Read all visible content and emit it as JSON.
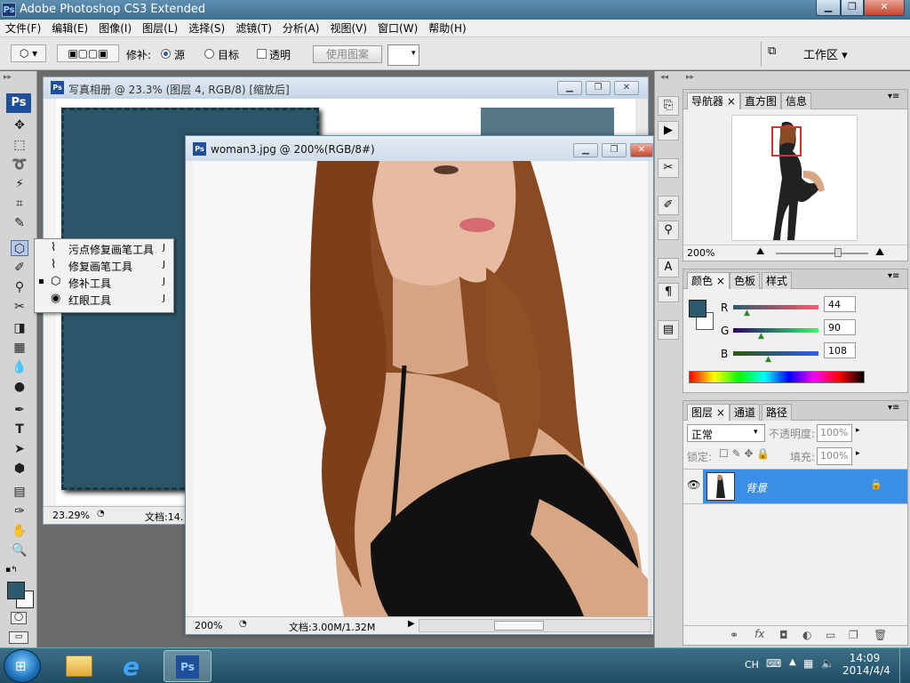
{
  "window": {
    "title": "Adobe Photoshop CS3 Extended",
    "logo": "Ps"
  },
  "menu": [
    "文件(F)",
    "编辑(E)",
    "图像(I)",
    "图层(L)",
    "选择(S)",
    "滤镜(T)",
    "分析(A)",
    "视图(V)",
    "窗口(W)",
    "帮助(H)"
  ],
  "options": {
    "patch_label": "修补:",
    "source_label": "源",
    "destination_label": "目标",
    "transparent_label": "透明",
    "use_pattern_label": "使用图案",
    "workspace_label": "工作区 ▾"
  },
  "toolbox": {
    "ps_label": "Ps"
  },
  "flyout": [
    {
      "label": "污点修复画笔工具",
      "key": "J",
      "active": false
    },
    {
      "label": "修复画笔工具",
      "key": "J",
      "active": false
    },
    {
      "label": "修补工具",
      "key": "J",
      "active": true
    },
    {
      "label": "红眼工具",
      "key": "J",
      "active": false
    }
  ],
  "doc1": {
    "title": "写真相册 @ 23.3% (图层 4, RGB/8) [缩放后]",
    "zoom": "23.29%",
    "doc_info": "文档:14."
  },
  "doc2": {
    "title": "woman3.jpg @ 200%(RGB/8#)",
    "zoom": "200%",
    "doc_info": "文档:3.00M/1.32M"
  },
  "navigator": {
    "tabs": [
      "导航器",
      "直方图",
      "信息"
    ],
    "zoom": "200%"
  },
  "color": {
    "tabs": [
      "颜色",
      "色板",
      "样式"
    ],
    "r_label": "R",
    "g_label": "G",
    "b_label": "B",
    "r": "44",
    "g": "90",
    "b": "108",
    "swatch": "#2c5a6c"
  },
  "layers": {
    "tabs": [
      "图层",
      "通道",
      "路径"
    ],
    "blend_mode": "正常",
    "opacity_label": "不透明度:",
    "opacity": "100%",
    "lock_label": "锁定:",
    "fill_label": "填充:",
    "fill": "100%",
    "layer_name": "背景"
  },
  "taskbar": {
    "lang": "CH",
    "time": "14:09",
    "date": "2014/4/4"
  }
}
